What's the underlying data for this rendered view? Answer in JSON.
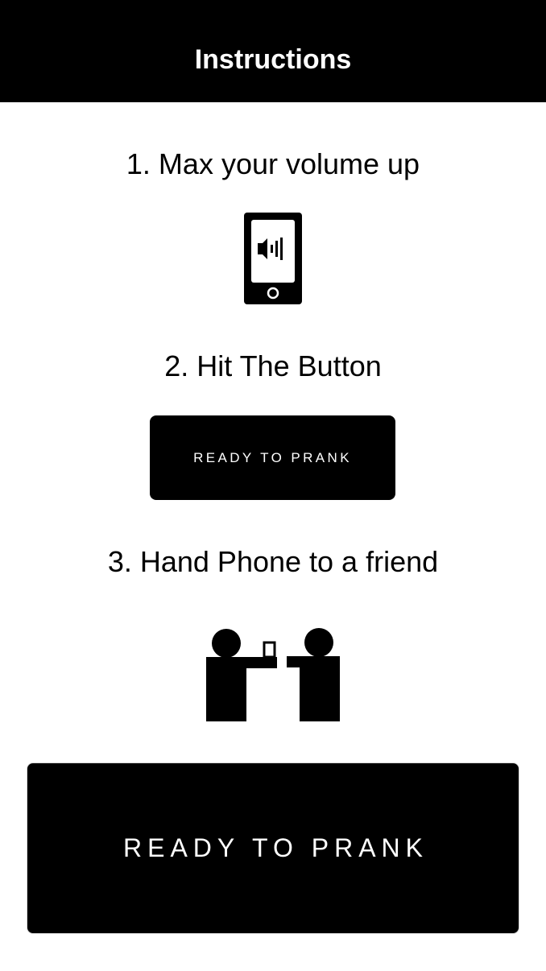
{
  "header": {
    "title": "Instructions"
  },
  "steps": [
    {
      "text": "1. Max your volume up",
      "icon": "phone-volume-icon"
    },
    {
      "text": "2. Hit The Button",
      "icon": "button-preview",
      "button_label": "READY TO PRANK"
    },
    {
      "text": "3. Hand Phone to a friend",
      "icon": "hand-phone-to-friend-icon"
    }
  ],
  "primary_action": {
    "label": "READY TO PRANK"
  },
  "colors": {
    "background": "#ffffff",
    "bar": "#000000",
    "text": "#000000",
    "button_text": "#ffffff"
  }
}
